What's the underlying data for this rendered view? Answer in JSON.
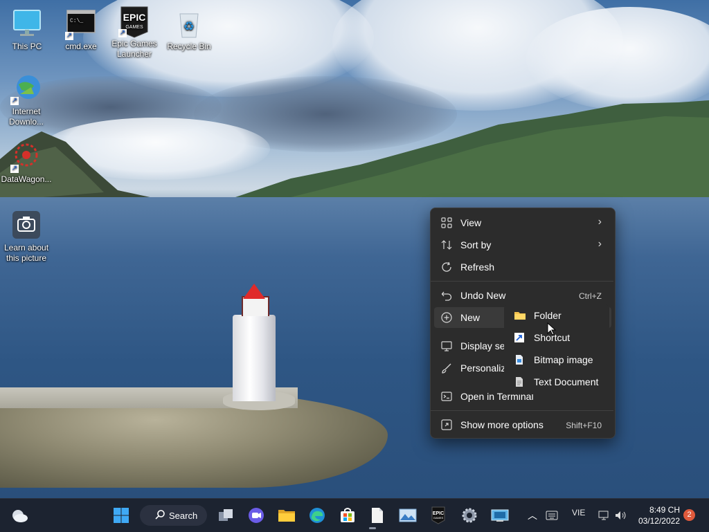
{
  "desktop": {
    "icons": [
      {
        "label": "This PC"
      },
      {
        "label": "cmd.exe"
      },
      {
        "label": "Epic Games Launcher"
      },
      {
        "label": "Recycle Bin"
      },
      {
        "label": "Internet Downlo..."
      },
      {
        "label": "DataWagon..."
      },
      {
        "label": "Learn about this picture"
      }
    ]
  },
  "context_menu": {
    "items": [
      {
        "label": "View",
        "icon": "grid-icon",
        "submenu": true
      },
      {
        "label": "Sort by",
        "icon": "sort-icon",
        "submenu": true
      },
      {
        "label": "Refresh",
        "icon": "refresh-icon"
      },
      {
        "label": "Undo New",
        "icon": "undo-icon",
        "shortcut": "Ctrl+Z"
      },
      {
        "label": "New",
        "icon": "plus-circle-icon",
        "highlighted": true
      },
      {
        "label": "Display set",
        "icon": "display-icon"
      },
      {
        "label": "Personaliz",
        "icon": "brush-icon"
      },
      {
        "label": "Open in Terminal",
        "icon": "terminal-icon"
      },
      {
        "label": "Show more options",
        "icon": "more-options-icon",
        "shortcut": "Shift+F10"
      }
    ],
    "new_submenu": [
      {
        "label": "Folder",
        "icon": "folder-icon"
      },
      {
        "label": "Shortcut",
        "icon": "shortcut-icon"
      },
      {
        "label": "Bitmap image",
        "icon": "bitmap-icon"
      },
      {
        "label": "Text Document",
        "icon": "text-document-icon"
      }
    ]
  },
  "taskbar": {
    "search_label": "Search",
    "language": "VIE",
    "time": "8:49 CH",
    "date": "03/12/2022",
    "notification_count": "2"
  },
  "colors": {
    "menu_bg": "#2c2c2c",
    "taskbar_bg": "#1c2330",
    "accent_blue": "#3d8fe0",
    "badge": "#e05a3c"
  }
}
